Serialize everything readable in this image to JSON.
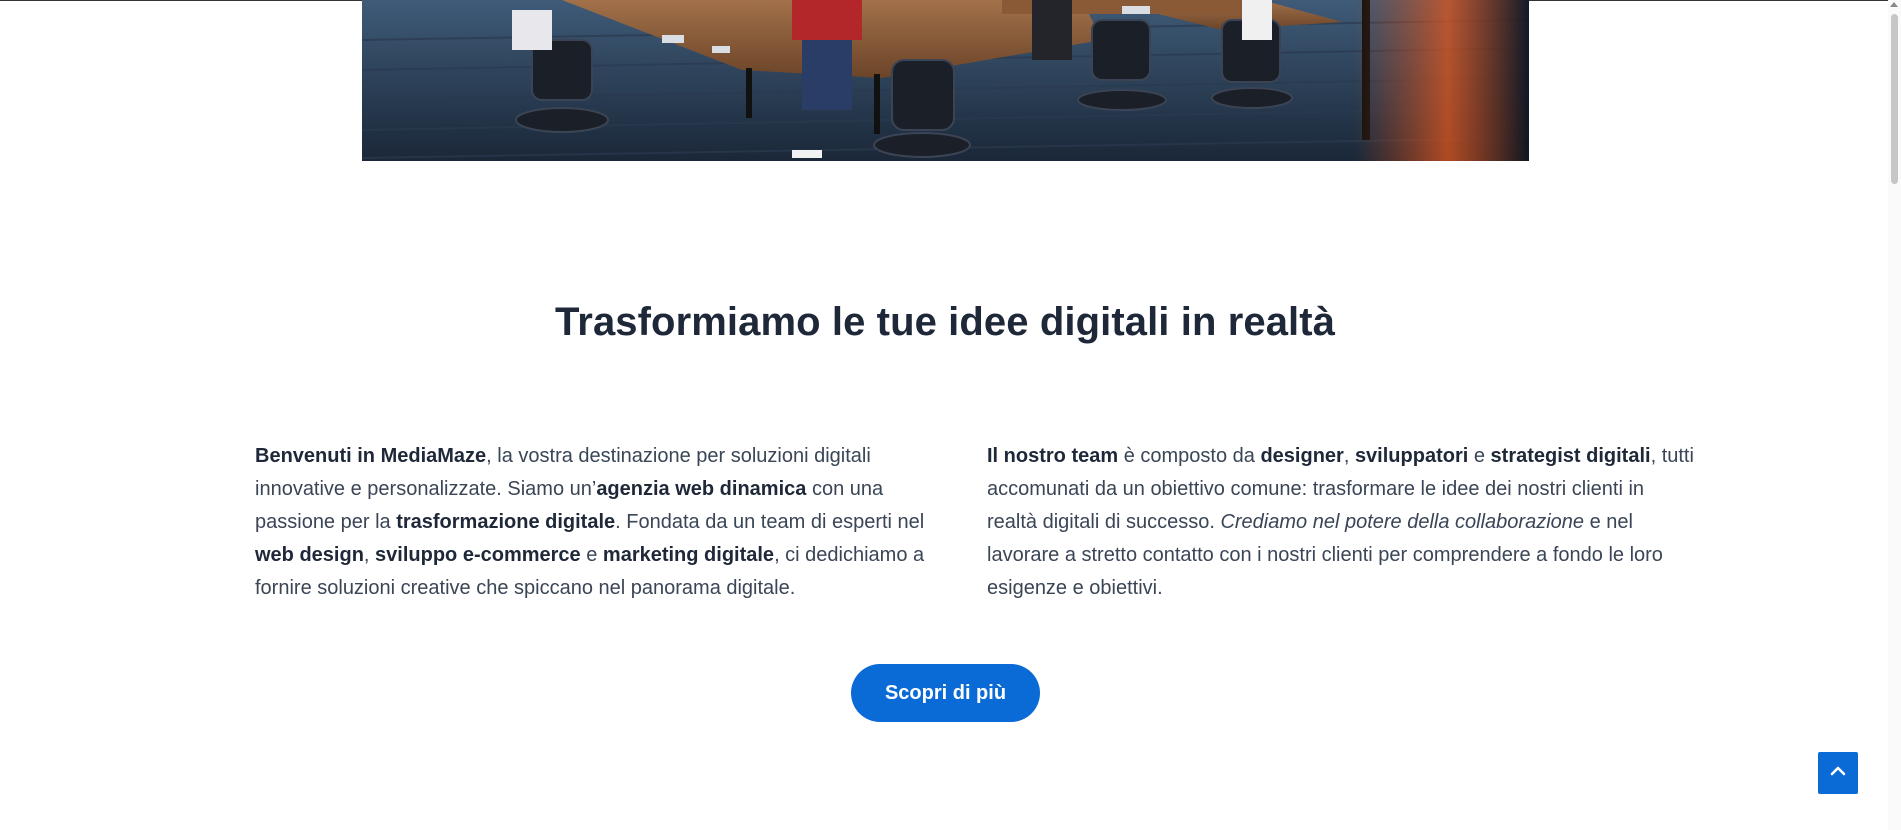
{
  "section": {
    "title": "Trasformiamo le tue idee digitali in realtà"
  },
  "left_column": {
    "p1_b1": "Benvenuti in MediaMaze",
    "p1_t1": ", la vostra destinazione per soluzioni digitali innovative e personalizzate. Siamo un’",
    "p1_b2": "agenzia web dinamica",
    "p1_t2": " con una passione per la ",
    "p1_b3": "trasformazione digitale",
    "p1_t3": ". Fondata da un team di esperti nel ",
    "p1_b4": "web design",
    "p1_t4": ", ",
    "p1_b5": "sviluppo e-commerce",
    "p1_t5": " e ",
    "p1_b6": "marketing digitale",
    "p1_t6": ", ci dedichiamo a fornire soluzioni creative che spiccano nel panorama digitale."
  },
  "right_column": {
    "p2_b1": "Il nostro team",
    "p2_t1": " è composto da ",
    "p2_b2": "designer",
    "p2_t2": ", ",
    "p2_b3": "sviluppatori",
    "p2_t3": " e ",
    "p2_b4": "strategist digitali",
    "p2_t4": ", tutti accomunati da un obiettivo comune: trasformare le idee dei nostri clienti in realtà digitali di successo. ",
    "p2_i1": "Crediamo nel potere della collaborazione",
    "p2_t5": " e nel lavorare a stretto contatto con i nostri clienti per comprendere a fondo le loro esigenze e obiettivi."
  },
  "cta": {
    "label": "Scopri di più"
  },
  "icons": {
    "back_to_top": "chevron-up-icon"
  },
  "colors": {
    "accent": "#0a6ad6",
    "heading": "#1e2838",
    "body_text": "#3a4556"
  }
}
